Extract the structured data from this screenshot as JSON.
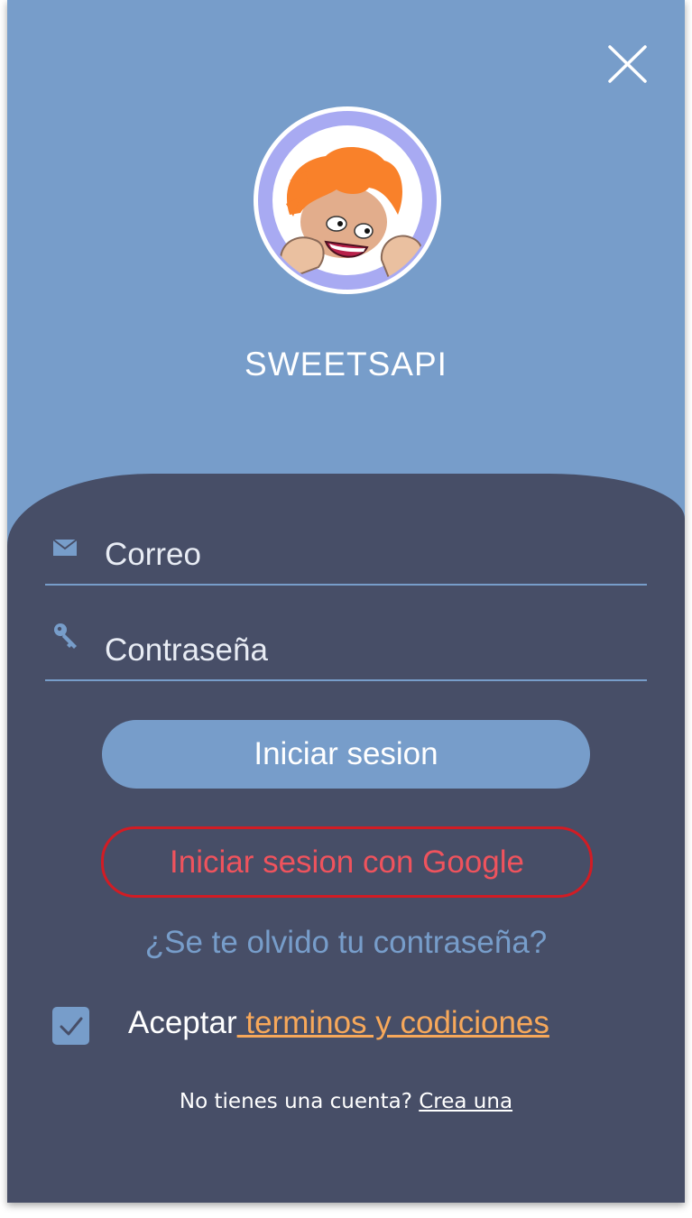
{
  "app": {
    "title": "SWEETSAPI",
    "colors": {
      "header_bg": "#779dca",
      "panel_bg": "#474e67",
      "google_border": "#d21c24",
      "google_text": "#ef535d",
      "terms_link": "#f7a85a"
    }
  },
  "header": {
    "close_icon": "close-icon",
    "avatar_icon": "cartoon-mascot-avatar"
  },
  "form": {
    "email": {
      "icon": "envelope-icon",
      "placeholder": "Correo",
      "value": ""
    },
    "password": {
      "icon": "key-icon",
      "placeholder": "Contraseña",
      "value": ""
    },
    "login_label": "Iniciar sesion",
    "google_label": "Iniciar sesion con Google",
    "forgot_label": "¿Se te olvido tu contraseña?",
    "terms": {
      "checked": true,
      "prefix": "Aceptar",
      "link": " terminos y codiciones"
    },
    "register": {
      "prefix": "No tienes una cuenta?",
      "link": "Crea una"
    }
  }
}
